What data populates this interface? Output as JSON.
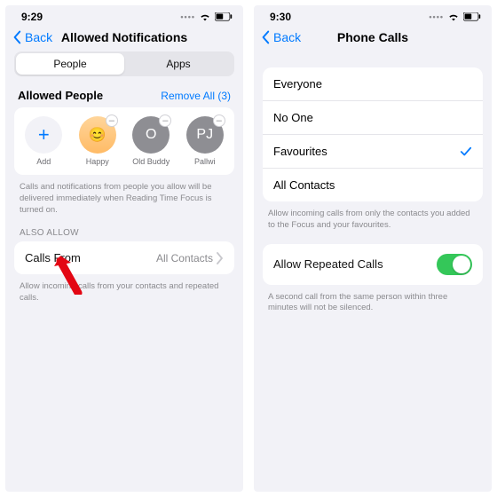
{
  "left": {
    "time": "9:29",
    "back": "Back",
    "title": "Allowed Notifications",
    "seg": {
      "people": "People",
      "apps": "Apps"
    },
    "section_title": "Allowed People",
    "remove_all": "Remove All (3)",
    "people": [
      {
        "label": "Add"
      },
      {
        "label": "Happy"
      },
      {
        "label": "Old Buddy",
        "initial": "O"
      },
      {
        "label": "Pallwi",
        "initial": "PJ"
      }
    ],
    "helper1": "Calls and notifications from people you allow will be delivered immediately when Reading Time Focus is turned on.",
    "also_allow": "ALSO ALLOW",
    "calls_from": "Calls From",
    "calls_value": "All Contacts",
    "helper2": "Allow incoming calls from your contacts and repeated calls."
  },
  "right": {
    "time": "9:30",
    "back": "Back",
    "title": "Phone Calls",
    "options": [
      "Everyone",
      "No One",
      "Favourites",
      "All Contacts"
    ],
    "selected": "Favourites",
    "helper1": "Allow incoming calls from only the contacts you added to the Focus and your favourites.",
    "repeat_label": "Allow Repeated Calls",
    "helper2": "A second call from the same person within three minutes will not be silenced."
  }
}
